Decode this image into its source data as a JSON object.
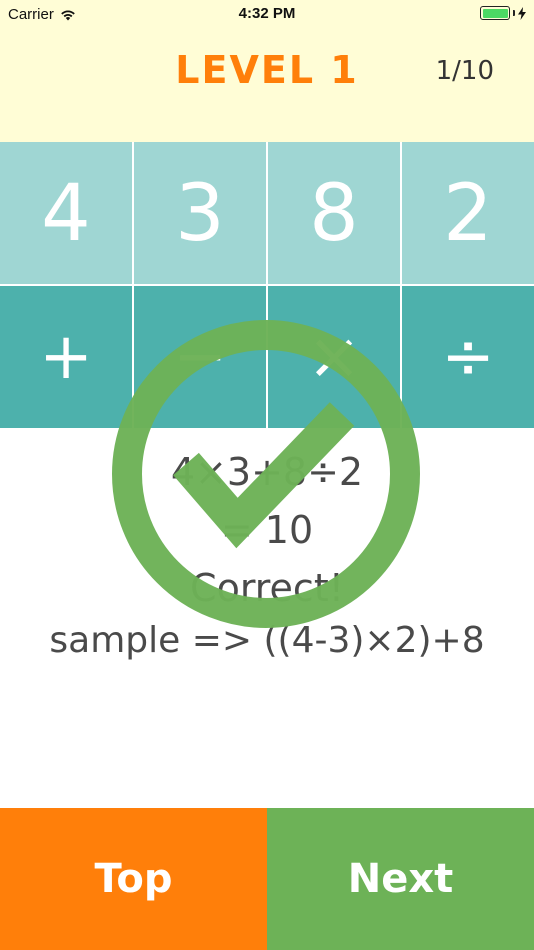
{
  "status_bar": {
    "carrier": "Carrier",
    "time": "4:32 PM",
    "icons": [
      "wifi-icon",
      "battery-icon",
      "charging-bolt-icon"
    ]
  },
  "header": {
    "title": "LEVEL 1",
    "progress": "1/10"
  },
  "numbers": [
    "4",
    "3",
    "8",
    "2"
  ],
  "operators": [
    "+",
    "−",
    "×",
    "÷"
  ],
  "result": {
    "expression": "4×3+8÷2",
    "equals": "= 10",
    "verdict": "Correct!",
    "sample": "sample => ((4-3)×2)+8"
  },
  "overlay": {
    "icon": "checkmark-circle-icon"
  },
  "buttons": {
    "top_label": "Top",
    "next_label": "Next"
  },
  "colors": {
    "header_bg": "#fffdd6",
    "accent_orange": "#ff7f0a",
    "numbers_bg": "#9fd6d3",
    "ops_bg": "#4db1ac",
    "success_green": "#6db257"
  }
}
